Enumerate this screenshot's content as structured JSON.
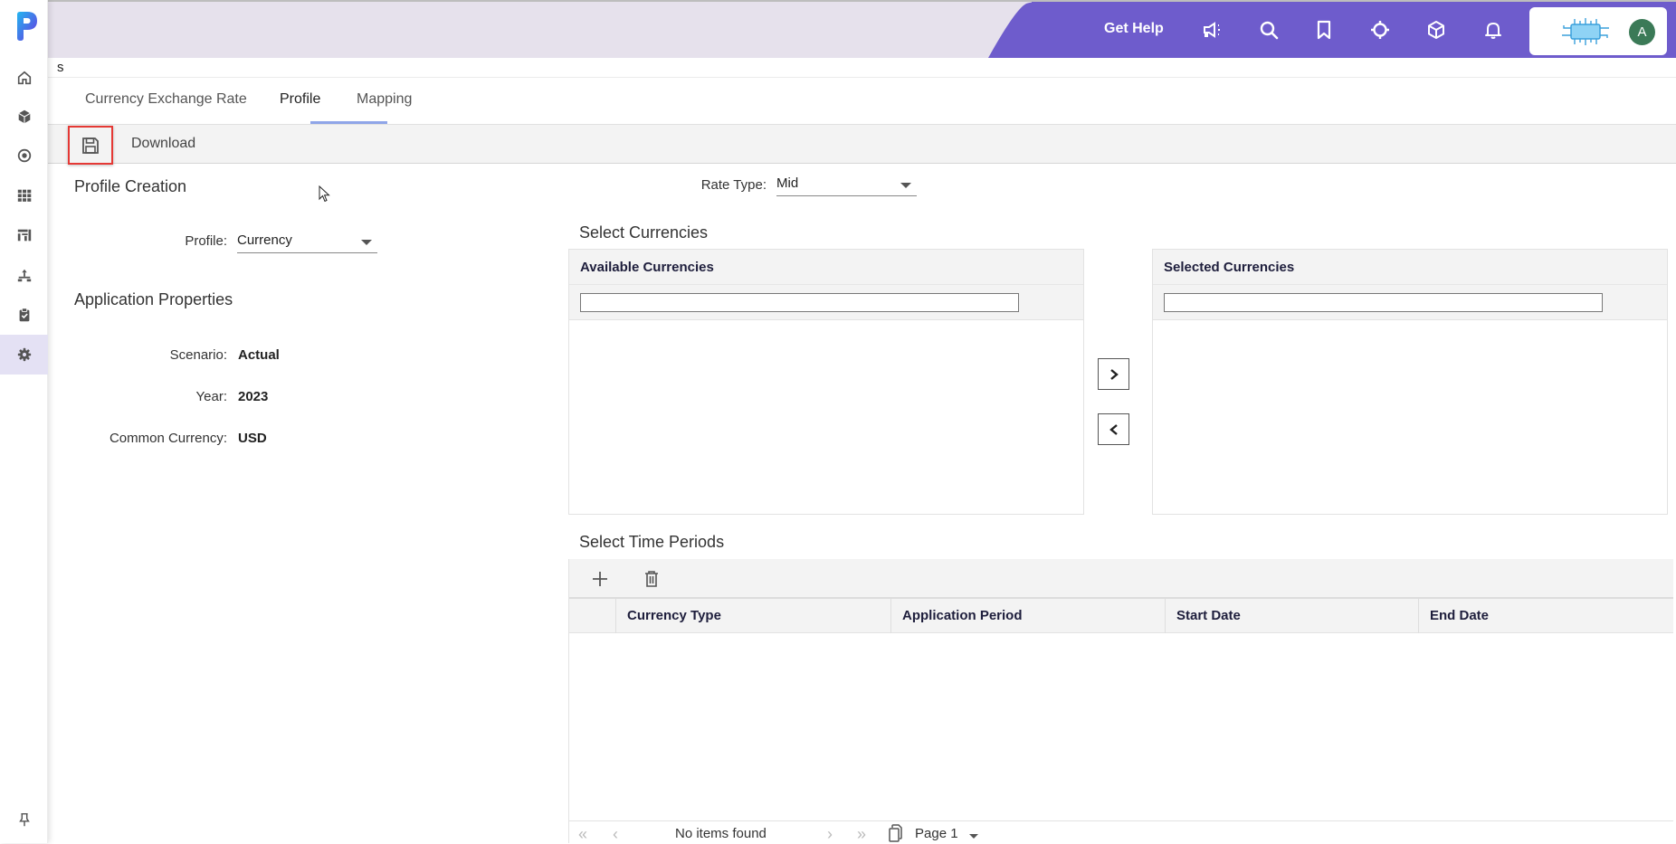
{
  "app": {
    "logo_icon": "app-logo-p",
    "brand_color": "#6e5ccc"
  },
  "rail": {
    "items": [
      {
        "name": "home",
        "icon": "home-icon"
      },
      {
        "name": "models",
        "icon": "cube-icon"
      },
      {
        "name": "target",
        "icon": "target-icon"
      },
      {
        "name": "grid",
        "icon": "grid-icon"
      },
      {
        "name": "reports",
        "icon": "chart-icon"
      },
      {
        "name": "hierarchy",
        "icon": "hierarchy-icon"
      },
      {
        "name": "tasks",
        "icon": "clipboard-check-icon"
      },
      {
        "name": "settings",
        "icon": "gear-icon",
        "active": true
      }
    ],
    "pin_icon": "pin-icon"
  },
  "topbar": {
    "get_help": "Get Help",
    "icons": [
      "megaphone-icon",
      "search-icon",
      "bookmark-icon",
      "crosshair-icon",
      "box-icon",
      "bell-icon"
    ],
    "avatar_initial": "A"
  },
  "breadcrumb": "s",
  "tabs": [
    {
      "label": "Currency Exchange Rate",
      "active": false
    },
    {
      "label": "Profile",
      "active": true
    },
    {
      "label": "Mapping",
      "active": false
    }
  ],
  "toolbar": {
    "save_icon": "save-icon",
    "download_label": "Download"
  },
  "profile_creation": {
    "title": "Profile Creation",
    "profile_label": "Profile:",
    "profile_value": "Currency"
  },
  "rate_type": {
    "label": "Rate Type:",
    "value": "Mid"
  },
  "application_properties": {
    "title": "Application Properties",
    "fields": [
      {
        "label": "Scenario:",
        "value": "Actual"
      },
      {
        "label": "Year:",
        "value": "2023"
      },
      {
        "label": "Common Currency:",
        "value": "USD"
      }
    ]
  },
  "select_currencies": {
    "title": "Select Currencies",
    "available_header": "Available Currencies",
    "available_filter": "",
    "selected_header": "Selected Currencies",
    "selected_filter": "",
    "move_right_icon": "chevron-right-icon",
    "move_left_icon": "chevron-left-icon"
  },
  "time_periods": {
    "title": "Select Time Periods",
    "columns": [
      "Currency Type",
      "Application Period",
      "Start Date",
      "End Date"
    ],
    "rows": [],
    "pager": {
      "message": "No items found",
      "page_label": "Page 1"
    }
  }
}
